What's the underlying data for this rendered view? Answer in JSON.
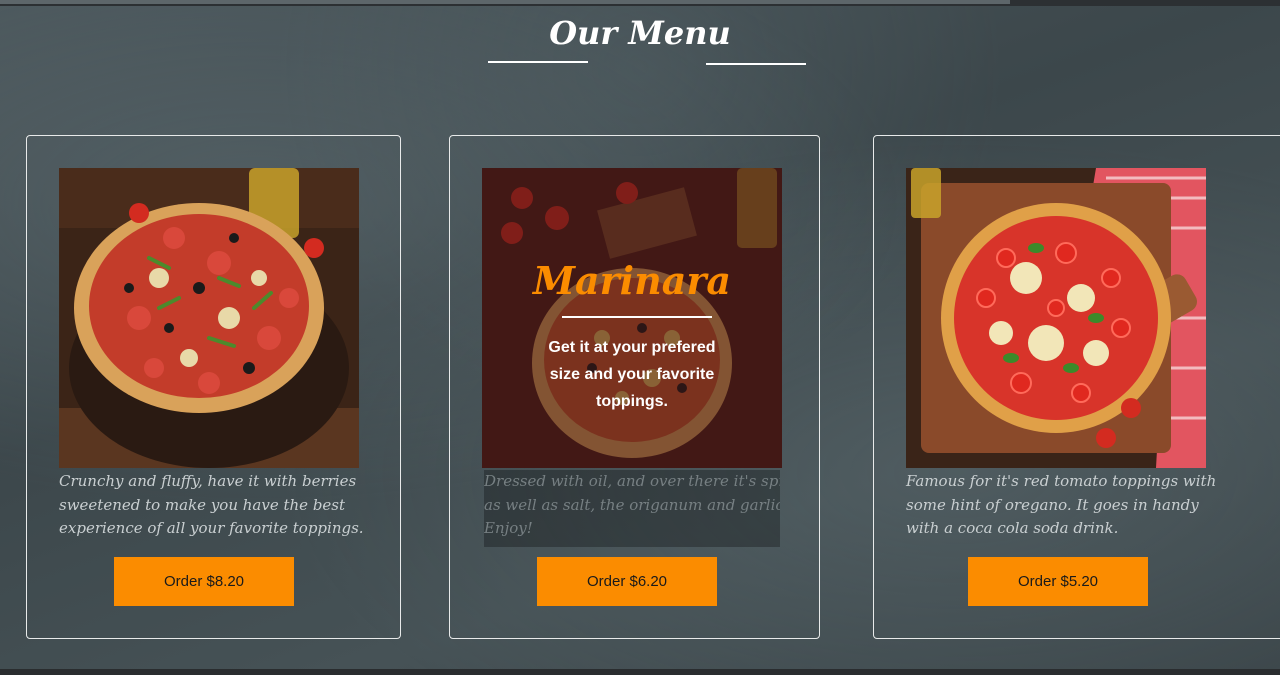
{
  "menu": {
    "title": "Our Menu"
  },
  "cards": [
    {
      "image": "pizza-with-olives-and-salami",
      "description": "Crunchy and fluffy, have it with berries sweetened to make you have the best experience of all your favorite toppings.",
      "order_label": "Order $8.20"
    },
    {
      "image": "marinara-pizza",
      "overlay_title": "Marinara",
      "overlay_text": "Get it at your prefered size and your favorite toppings.",
      "description_lines": [
        " Dressed with oil, and over there it's spread,",
        "as well as salt, the origanum and garlic cloves",
        "Enjoy!"
      ],
      "order_label": "Order $6.20"
    },
    {
      "image": "margherita-pizza",
      "description": "Famous for it's red tomato toppings with some hint of oregano. It goes in handy with a coca cola soda drink.",
      "order_label": "Order $5.20"
    }
  ],
  "colors": {
    "accent": "#fb8c00",
    "text_light": "#ffffff"
  }
}
